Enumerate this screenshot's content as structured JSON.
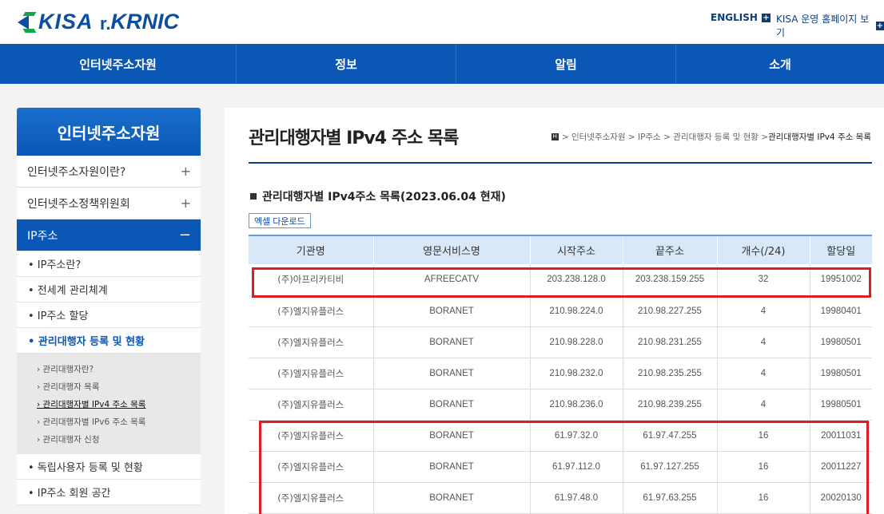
{
  "header": {
    "logo_kisa": "KISA",
    "logo_krnic_prefix": "r.",
    "logo_krnic": "KRNIC",
    "util_english": "ENGLISH",
    "util_kisa": "KISA 운영 홈페이지 보기",
    "plus_icon": "+"
  },
  "gnb": [
    "인터넷주소자원",
    "정보",
    "알림",
    "소개"
  ],
  "sidebar": {
    "title": "인터넷주소자원",
    "d1": [
      {
        "label": "인터넷주소자원이란?",
        "sign": "+"
      },
      {
        "label": "인터넷주소정책위원회",
        "sign": "+"
      },
      {
        "label": "IP주소",
        "sign": "−"
      }
    ],
    "d2": [
      "• IP주소란?",
      "• 전세계 관리체계",
      "• IP주소 할당",
      "• 관리대행자 등록 및 현황"
    ],
    "d3": [
      "› 관리대행자란?",
      "› 관리대행자 목록",
      "› 관리대행자별 IPv4 주소 목록",
      "› 관리대행자별 IPv6 주소 목록",
      "› 관리대행자 신청"
    ],
    "d2_after": [
      "• 독립사용자 등록 및 현황",
      "• IP주소 회원 공간"
    ]
  },
  "content": {
    "title": "관리대행자별 IPv4 주소 목록",
    "breadcrumb": {
      "home": "H",
      "items": [
        "> 인터넷주소자원",
        "> IP주소",
        "> 관리대행자 등록 및 현황",
        "> "
      ],
      "current": "관리대행자별 IPv4 주소 목록"
    },
    "sub_title": "관리대행자별 IPv4주소 목록(2023.06.04 현재)",
    "excel_button": "엑셀 다운로드",
    "table": {
      "headers": [
        "기관명",
        "영문서비스명",
        "시작주소",
        "끝주소",
        "개수(/24)",
        "할당일"
      ],
      "rows": [
        [
          "(주)아프리카티비",
          "AFREECATV",
          "203.238.128.0",
          "203.238.159.255",
          "32",
          "19951002"
        ],
        [
          "(주)엘지유플러스",
          "BORANET",
          "210.98.224.0",
          "210.98.227.255",
          "4",
          "19980401"
        ],
        [
          "(주)엘지유플러스",
          "BORANET",
          "210.98.228.0",
          "210.98.231.255",
          "4",
          "19980501"
        ],
        [
          "(주)엘지유플러스",
          "BORANET",
          "210.98.232.0",
          "210.98.235.255",
          "4",
          "19980501"
        ],
        [
          "(주)엘지유플러스",
          "BORANET",
          "210.98.236.0",
          "210.98.239.255",
          "4",
          "19980501"
        ],
        [
          "(주)엘지유플러스",
          "BORANET",
          "61.97.32.0",
          "61.97.47.255",
          "16",
          "20011031"
        ],
        [
          "(주)엘지유플러스",
          "BORANET",
          "61.97.112.0",
          "61.97.127.255",
          "16",
          "20011227"
        ],
        [
          "(주)엘지유플러스",
          "BORANET",
          "61.97.48.0",
          "61.97.63.255",
          "16",
          "20020130"
        ]
      ]
    }
  },
  "colors": {
    "brand_blue": "#0a57b5",
    "highlight_red": "#e11b26"
  }
}
